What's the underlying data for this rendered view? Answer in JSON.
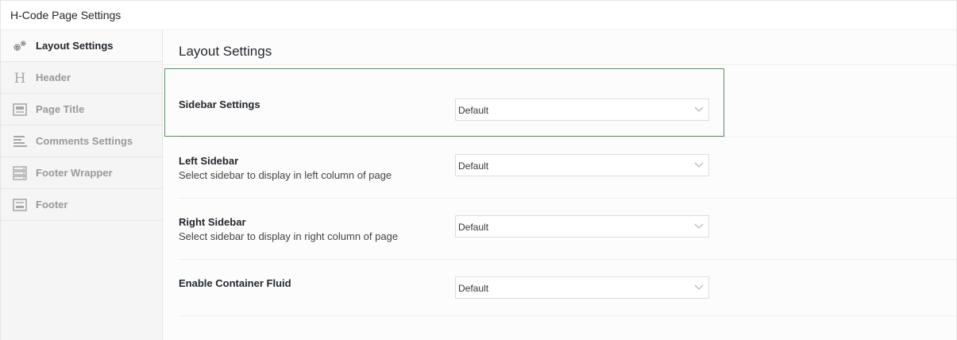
{
  "panel": {
    "title": "H-Code Page Settings"
  },
  "sidebar": {
    "items": [
      {
        "label": "Layout Settings",
        "icon": "gears-icon",
        "active": true
      },
      {
        "label": "Header",
        "icon": "header-h-icon",
        "active": false
      },
      {
        "label": "Page Title",
        "icon": "page-title-icon",
        "active": false
      },
      {
        "label": "Comments Settings",
        "icon": "align-left-icon",
        "active": false
      },
      {
        "label": "Footer Wrapper",
        "icon": "server-icon",
        "active": false
      },
      {
        "label": "Footer",
        "icon": "footer-icon",
        "active": false
      }
    ]
  },
  "main": {
    "title": "Layout Settings",
    "fields": [
      {
        "label": "Sidebar Settings",
        "description": "",
        "value": "Default"
      },
      {
        "label": "Left Sidebar",
        "description": "Select sidebar to display in left column of page",
        "value": "Default"
      },
      {
        "label": "Right Sidebar",
        "description": "Select sidebar to display in right column of page",
        "value": "Default"
      },
      {
        "label": "Enable Container Fluid",
        "description": "",
        "value": "Default"
      }
    ]
  },
  "colors": {
    "focus_border": "#5e8c66",
    "sidebar_bg": "#f5f5f5",
    "inactive_text": "#999999"
  }
}
